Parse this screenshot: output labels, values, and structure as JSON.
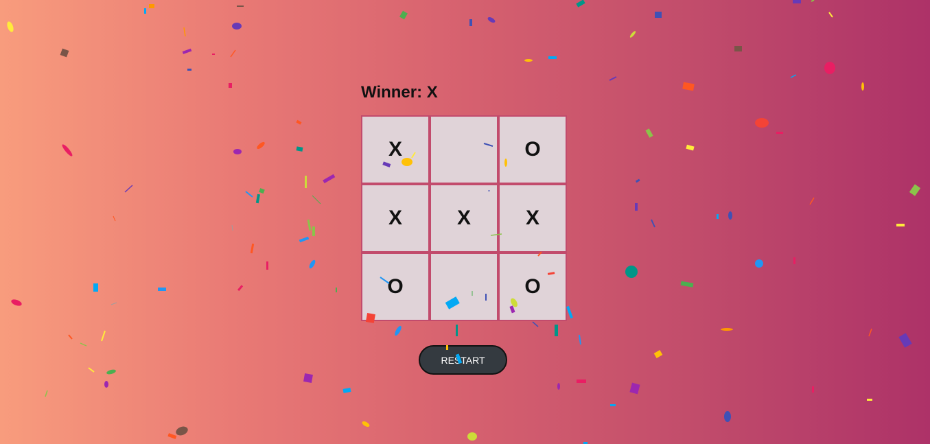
{
  "game": {
    "status_text": "Winner: X",
    "board": [
      [
        "X",
        "",
        "O"
      ],
      [
        "X",
        "X",
        "X"
      ],
      [
        "O",
        "",
        "O"
      ]
    ],
    "restart_label": "RESTART"
  },
  "colors": {
    "background_start": "#f89c7d",
    "background_end": "#ad3268",
    "board_border": "#c24b6c",
    "cell_background": "#e0d3d8",
    "button_background": "#343a40"
  }
}
